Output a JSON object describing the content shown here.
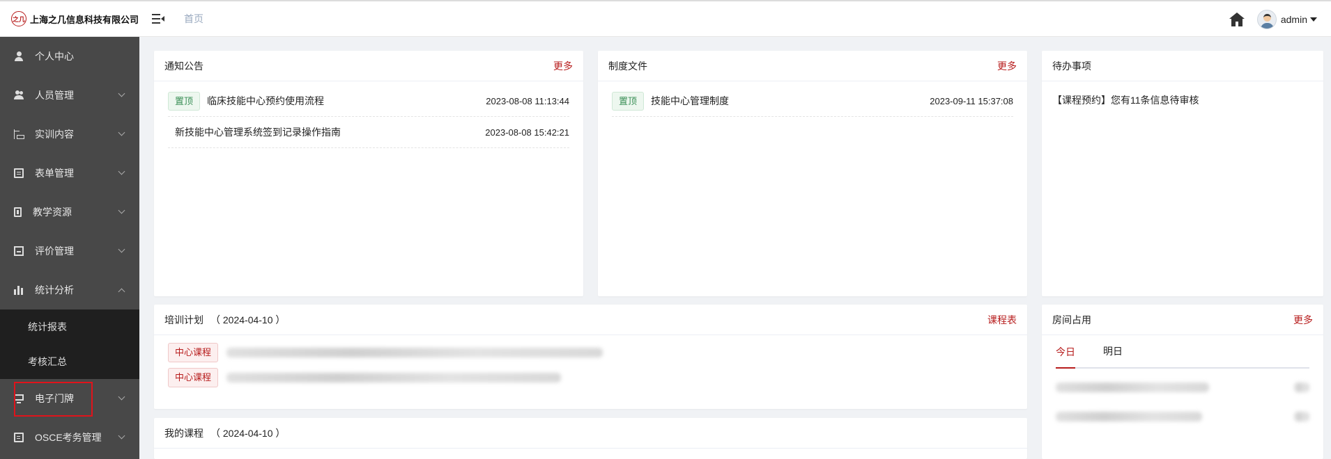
{
  "header": {
    "company": "上海之几信息科技有限公司",
    "logo_text": "之几",
    "breadcrumb": "首页",
    "user": "admin"
  },
  "sidebar": {
    "items": [
      {
        "label": "个人中心",
        "icon": "user-icon",
        "chevron": false
      },
      {
        "label": "人员管理",
        "icon": "users-icon",
        "chevron": "down"
      },
      {
        "label": "实训内容",
        "icon": "tree-icon",
        "chevron": "down"
      },
      {
        "label": "表单管理",
        "icon": "form-icon",
        "chevron": "down"
      },
      {
        "label": "教学资源",
        "icon": "book-icon",
        "chevron": "down"
      },
      {
        "label": "评价管理",
        "icon": "evaluation-icon",
        "chevron": "down"
      },
      {
        "label": "统计分析",
        "icon": "bar-chart-icon",
        "chevron": "up"
      },
      {
        "label": "电子门牌",
        "icon": "monitor-icon",
        "chevron": "down"
      },
      {
        "label": "OSCE考务管理",
        "icon": "document-icon",
        "chevron": "down"
      }
    ],
    "submenu": [
      "统计报表",
      "考核汇总"
    ]
  },
  "notice": {
    "title": "通知公告",
    "more": "更多",
    "rows": [
      {
        "tag": "置顶",
        "title": "临床技能中心预约使用流程",
        "time": "2023-08-08 11:13:44"
      },
      {
        "tag": "",
        "title": "新技能中心管理系统签到记录操作指南",
        "time": "2023-08-08 15:42:21"
      }
    ]
  },
  "rules": {
    "title": "制度文件",
    "more": "更多",
    "rows": [
      {
        "tag": "置顶",
        "title": "技能中心管理制度",
        "time": "2023-09-11 15:37:08"
      }
    ]
  },
  "todo": {
    "title": "待办事项",
    "items": [
      "【课程预约】您有11条信息待审核"
    ]
  },
  "training": {
    "title": "培训计划",
    "date": "（ 2024-04-10 ）",
    "link": "课程表",
    "rows": [
      {
        "tag": "中心课程"
      },
      {
        "tag": "中心课程"
      }
    ]
  },
  "room": {
    "title": "房间占用",
    "more": "更多",
    "tabs": [
      "今日",
      "明日"
    ]
  },
  "mycourse": {
    "title": "我的课程",
    "date": "（ 2024-04-10 ）"
  },
  "colors": {
    "accent": "#b71c1c",
    "sidebar": "#484848",
    "submenu": "#1f1f1f",
    "highlight_box": "#e0131b"
  }
}
